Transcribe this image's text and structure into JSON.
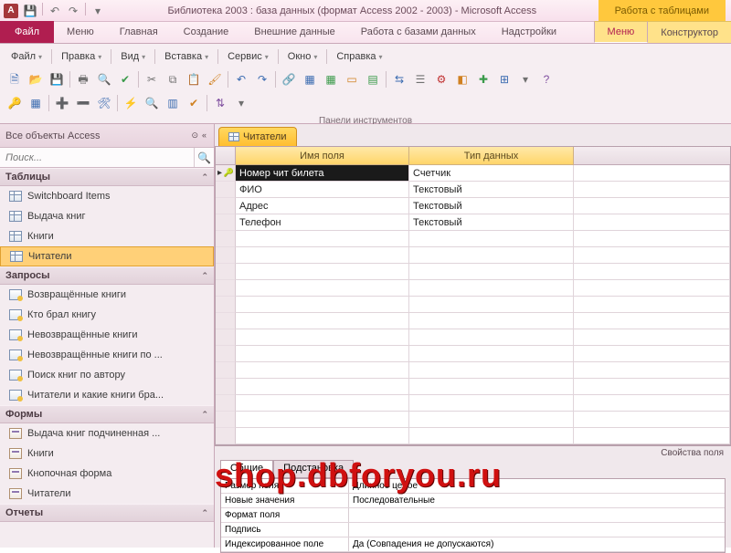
{
  "title": "Библиотека 2003 : база данных (формат Access 2002 - 2003)  -  Microsoft Access",
  "context_group": "Работа с таблицами",
  "tabs": {
    "file": "Файл",
    "items": [
      "Меню",
      "Главная",
      "Создание",
      "Внешние данные",
      "Работа с базами данных",
      "Надстройки"
    ],
    "context": [
      "Меню",
      "Конструктор"
    ],
    "active": "Меню"
  },
  "menus": {
    "file": "Файл",
    "edit": "Правка",
    "view": "Вид",
    "insert": "Вставка",
    "service": "Сервис",
    "window": "Окно",
    "help": "Справка"
  },
  "ribbon_group": "Панели инструментов",
  "nav": {
    "header": "Все объекты Access",
    "search_placeholder": "Поиск...",
    "groups": [
      {
        "title": "Таблицы",
        "kind": "table",
        "items": [
          "Switchboard Items",
          "Выдача книг",
          "Книги",
          "Читатели"
        ],
        "selected": "Читатели"
      },
      {
        "title": "Запросы",
        "kind": "query",
        "items": [
          "Возвращённые книги",
          "Кто брал книгу",
          "Невозвращённые книги",
          "Невозвращённые книги по ...",
          "Поиск книг по автору",
          "Читатели и какие книги бра..."
        ]
      },
      {
        "title": "Формы",
        "kind": "form",
        "items": [
          "Выдача книг подчиненная ...",
          "Книги",
          "Кнопочная форма",
          "Читатели"
        ]
      },
      {
        "title": "Отчеты",
        "kind": "report",
        "items": []
      }
    ]
  },
  "doc": {
    "tab": "Читатели",
    "col_field": "Имя поля",
    "col_type": "Тип данных",
    "rows": [
      {
        "name": "Номер чит билета",
        "type": "Счетчик",
        "pk": true,
        "current": true,
        "selected": true
      },
      {
        "name": "ФИО",
        "type": "Текстовый"
      },
      {
        "name": "Адрес",
        "type": "Текстовый"
      },
      {
        "name": "Телефон",
        "type": "Текстовый"
      }
    ],
    "empty_rows": 13
  },
  "props": {
    "title": "Свойства поля",
    "tab_general": "Общие",
    "tab_lookup": "Подстановка",
    "rows": [
      {
        "label": "Размер поля",
        "value": "Длинное целое"
      },
      {
        "label": "Новые значения",
        "value": "Последовательные"
      },
      {
        "label": "Формат поля",
        "value": ""
      },
      {
        "label": "Подпись",
        "value": ""
      },
      {
        "label": "Индексированное поле",
        "value": "Да (Совпадения не допускаются)"
      }
    ]
  },
  "watermark": "shop.dbforyou.ru"
}
